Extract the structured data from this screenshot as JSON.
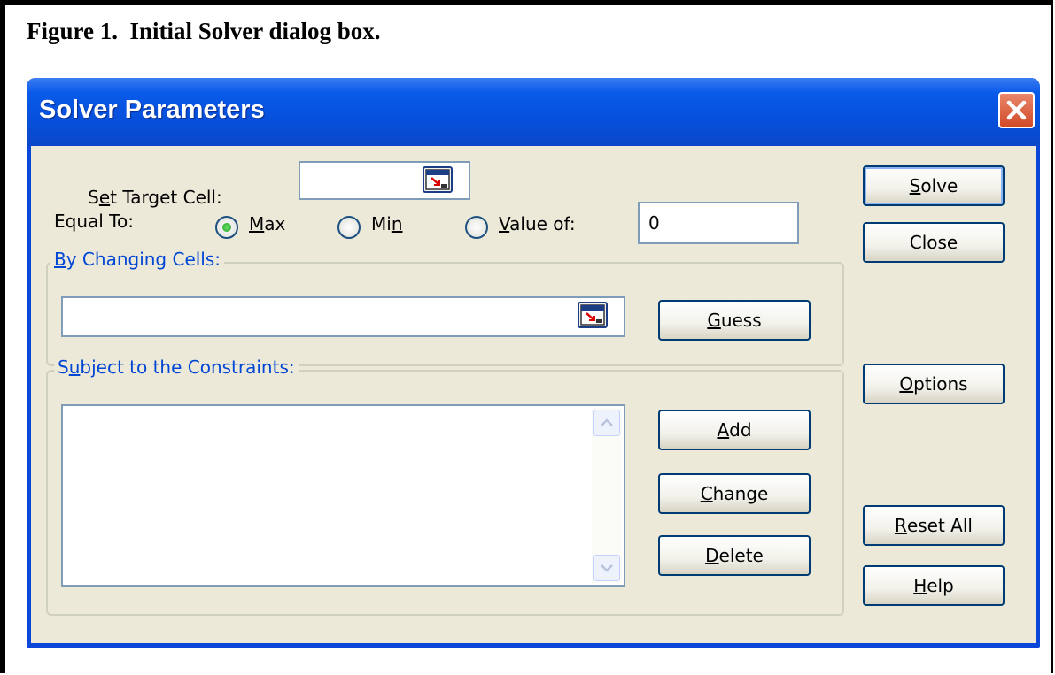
{
  "caption": "Figure 1.  Initial Solver dialog box.",
  "dialog": {
    "title": "Solver Parameters",
    "close_icon": "close-x-icon",
    "set_target_cell": {
      "label": "Set Target Cell:",
      "value": ""
    },
    "equal_to": {
      "label": "Equal To:",
      "options": [
        "Max",
        "Min",
        "Value of:"
      ],
      "selected": "Max",
      "value_of": "0"
    },
    "changing_cells": {
      "label": "By Changing Cells:",
      "value": ""
    },
    "constraints": {
      "label": "Subject to the Constraints:",
      "items": []
    },
    "buttons": {
      "solve": "Solve",
      "close": "Close",
      "guess": "Guess",
      "options": "Options",
      "add": "Add",
      "change": "Change",
      "delete": "Delete",
      "reset_all": "Reset All",
      "help": "Help"
    },
    "colors": {
      "title_bar": "#0a5ae9",
      "client_bg": "#ece9d8",
      "group_label": "#0046d5",
      "close_button": "#d24a27"
    }
  }
}
